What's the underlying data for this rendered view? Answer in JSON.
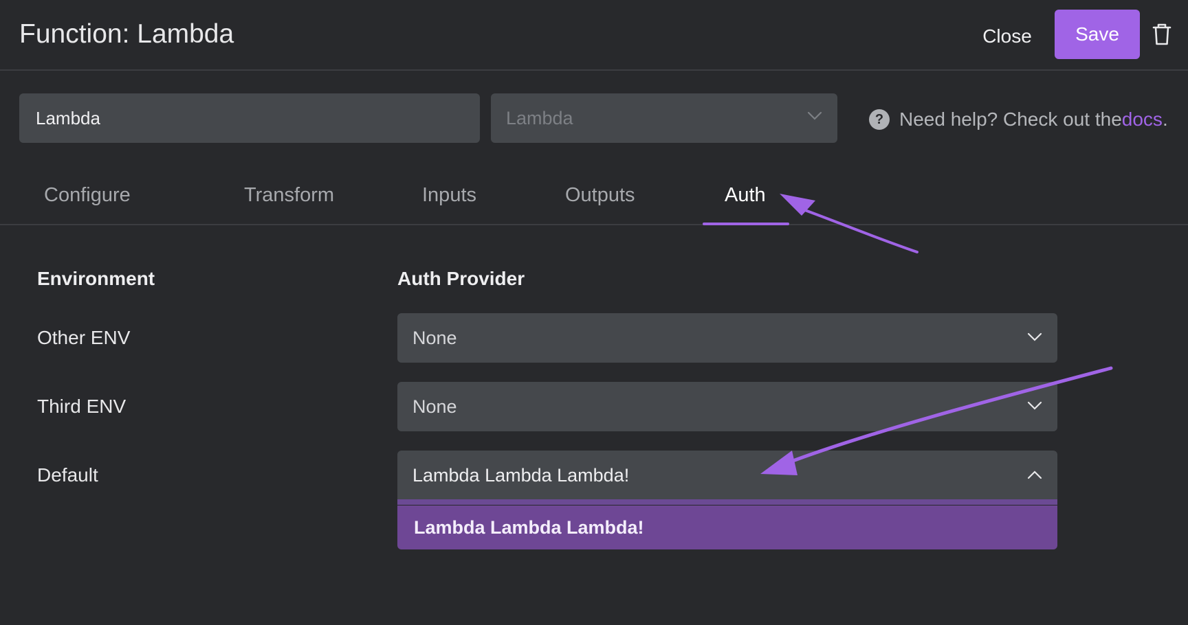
{
  "header": {
    "title": "Function: Lambda",
    "close_label": "Close",
    "save_label": "Save"
  },
  "form": {
    "name_value": "Lambda",
    "type_value": "Lambda"
  },
  "help": {
    "text": "Need help? Check out the ",
    "link": "docs",
    "suffix": "."
  },
  "tabs": [
    {
      "label": "Configure"
    },
    {
      "label": "Transform"
    },
    {
      "label": "Inputs"
    },
    {
      "label": "Outputs"
    },
    {
      "label": "Auth",
      "active": true
    }
  ],
  "auth": {
    "env_header": "Environment",
    "provider_header": "Auth Provider",
    "rows": [
      {
        "env": "Other ENV",
        "provider": "None"
      },
      {
        "env": "Third ENV",
        "provider": "None"
      },
      {
        "env": "Default",
        "provider": "Lambda Lambda Lambda!",
        "open": true
      }
    ],
    "dropdown_options": [
      "Lambda Lambda Lambda!"
    ]
  },
  "colors": {
    "accent": "#a064e6",
    "background": "#28292c",
    "field": "#45484c",
    "option_highlight": "#6e4795"
  },
  "icons": [
    "trash-icon",
    "chevron-down-icon",
    "chevron-up-icon",
    "help-icon",
    "annotation-arrow"
  ]
}
